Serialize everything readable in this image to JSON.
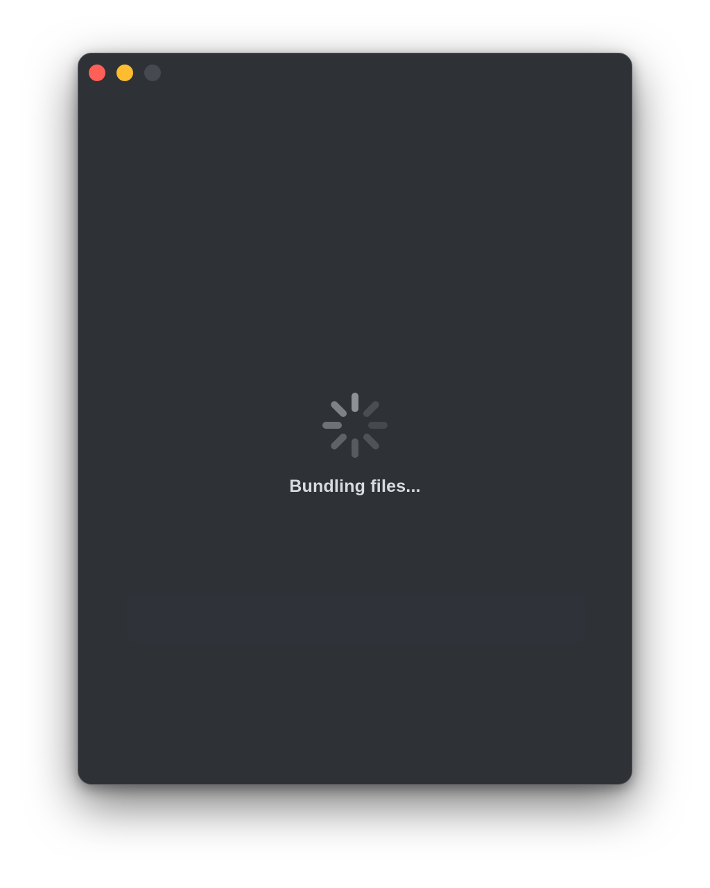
{
  "window": {
    "traffic_lights": {
      "close_color": "#fe5f57",
      "minimize_color": "#febc2e",
      "zoom_color": "#464a50"
    },
    "background_color": "#2e3136"
  },
  "loader": {
    "icon": "spinner-icon",
    "status_text": "Bundling files..."
  }
}
